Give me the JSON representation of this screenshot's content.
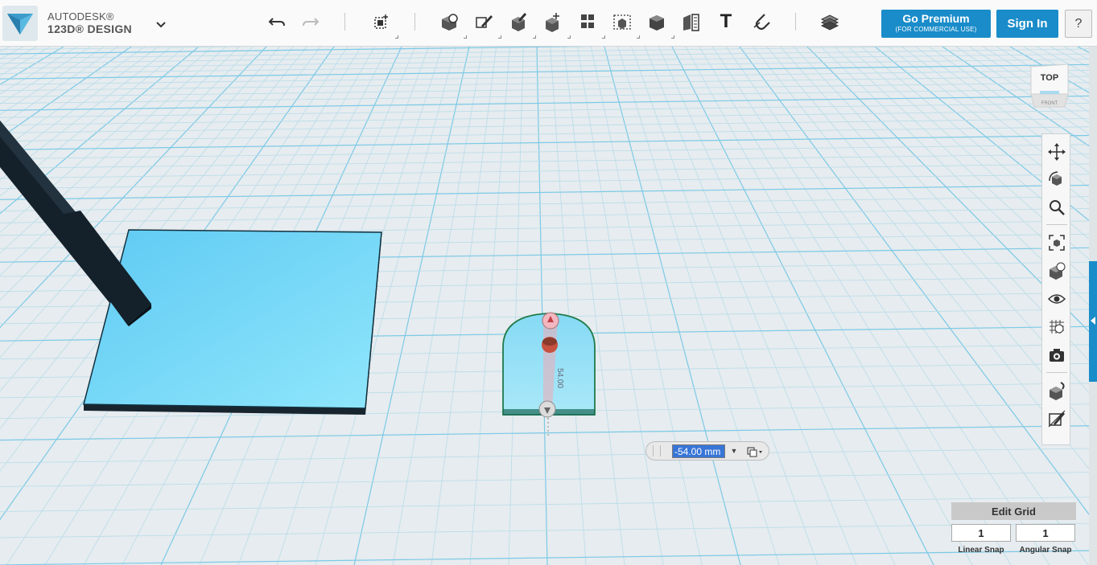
{
  "app": {
    "brand_top": "AUTODESK®",
    "brand_bottom": "123D® DESIGN"
  },
  "toolbar": {
    "icons": [
      "undo-icon",
      "redo-icon",
      "transform-icon",
      "primitives-icon",
      "sketch-icon",
      "construct-icon",
      "modify-icon",
      "pattern-icon",
      "grouping-icon",
      "combine-icon",
      "measure-icon",
      "text-icon",
      "snap-icon",
      "materials-icon"
    ],
    "text_tool_label": "T"
  },
  "account": {
    "go_premium_label": "Go Premium",
    "go_premium_sub": "(FOR COMMERCIAL USE)",
    "sign_in_label": "Sign In",
    "help_label": "?"
  },
  "viewcube": {
    "face_label": "TOP",
    "lower_face_label": "FRONT"
  },
  "navbar": {
    "icons": [
      "pan-icon",
      "orbit-icon",
      "zoom-icon",
      "fit-icon",
      "view-mode-icon",
      "visibility-icon",
      "grid-material-icon",
      "screenshot-icon",
      "snap-object-icon",
      "hide-sketch-icon"
    ]
  },
  "scene": {
    "dimension_label": "54.00"
  },
  "dimension_input": {
    "value": "-54.00 mm",
    "dropdown_glyph": "▼"
  },
  "grid": {
    "edit_label": "Edit Grid",
    "linear_snap_value": "1",
    "linear_snap_label": "Linear Snap",
    "angular_snap_value": "1",
    "angular_snap_label": "Angular Snap"
  },
  "colors": {
    "accent": "#1a8cc9",
    "grid_bg": "#e6ecef",
    "object_fill": "#6fd2f5",
    "selected_edge": "#1f7a4a"
  }
}
